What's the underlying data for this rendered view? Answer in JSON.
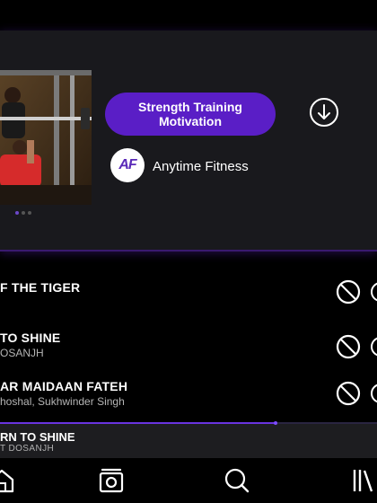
{
  "playlist_card": {
    "tag_label": "Strength Training Motivation",
    "brand": {
      "logo_text": "AF",
      "name": "Anytime Fitness"
    },
    "pager": {
      "count": 3,
      "active_index": 0
    },
    "icons": {
      "download": "download-circle-icon"
    }
  },
  "tracks": [
    {
      "title": "F THE TIGER",
      "artist": ""
    },
    {
      "title": "TO SHINE",
      "artist": "OSANJH"
    },
    {
      "title": "AR MAIDAAN FATEH",
      "artist": "hoshal, Sukhwinder Singh"
    }
  ],
  "track_icons": {
    "block": "block-icon",
    "more": "more-options-icon"
  },
  "now_playing": {
    "title": "RN TO SHINE",
    "artist": "T DOSANJH",
    "progress": 0.73
  },
  "bottom_nav": {
    "items": [
      {
        "name": "home",
        "icon": "home-icon"
      },
      {
        "name": "library",
        "icon": "library-icon"
      },
      {
        "name": "search",
        "icon": "search-icon"
      },
      {
        "name": "collection",
        "icon": "collection-icon"
      }
    ]
  },
  "colors": {
    "accent": "#5a1ec6",
    "card_bg": "#19191d",
    "background": "#000000",
    "progress": "#6a34e0"
  }
}
